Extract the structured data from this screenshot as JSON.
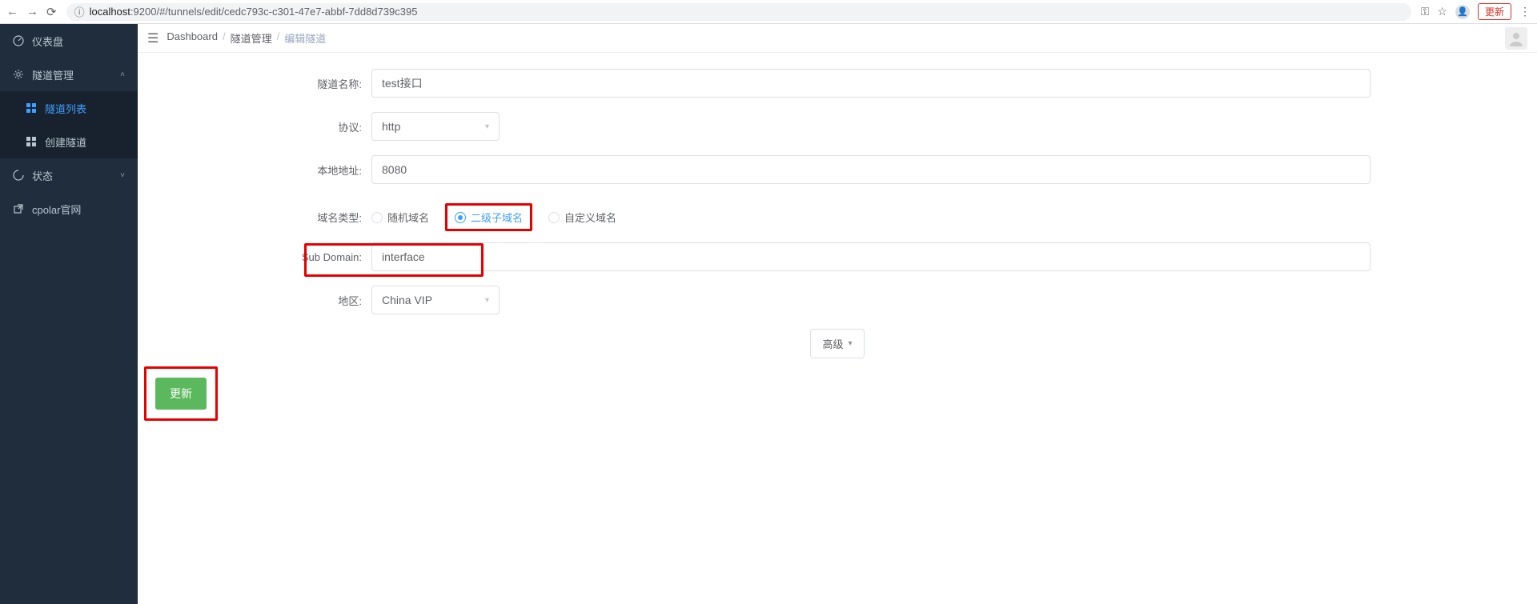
{
  "browser": {
    "url_host": "localhost",
    "url_port": ":9200",
    "url_path": "/#/tunnels/edit/cedc793c-c301-47e7-abbf-7dd8d739c395",
    "update_btn": "更新"
  },
  "sidebar": {
    "items": [
      {
        "label": "仪表盘",
        "icon": "dashboard"
      },
      {
        "label": "隧道管理",
        "icon": "gear",
        "expandable": true
      },
      {
        "label": "隧道列表",
        "icon": "grid",
        "sub": true,
        "active": true
      },
      {
        "label": "创建隧道",
        "icon": "grid",
        "sub": true
      },
      {
        "label": "状态",
        "icon": "loader",
        "expandable": true
      },
      {
        "label": "cpolar官网",
        "icon": "external"
      }
    ]
  },
  "breadcrumb": {
    "items": [
      "Dashboard",
      "隧道管理",
      "编辑隧道"
    ]
  },
  "form": {
    "name_label": "隧道名称:",
    "name_value": "test接口",
    "proto_label": "协议:",
    "proto_value": "http",
    "addr_label": "本地地址:",
    "addr_value": "8080",
    "domain_type_label": "域名类型:",
    "domain_options": [
      "随机域名",
      "二级子域名",
      "自定义域名"
    ],
    "domain_selected_index": 1,
    "subdomain_label": "Sub Domain:",
    "subdomain_value": "interface",
    "region_label": "地区:",
    "region_value": "China VIP",
    "advanced_label": "高级",
    "submit_label": "更新"
  }
}
